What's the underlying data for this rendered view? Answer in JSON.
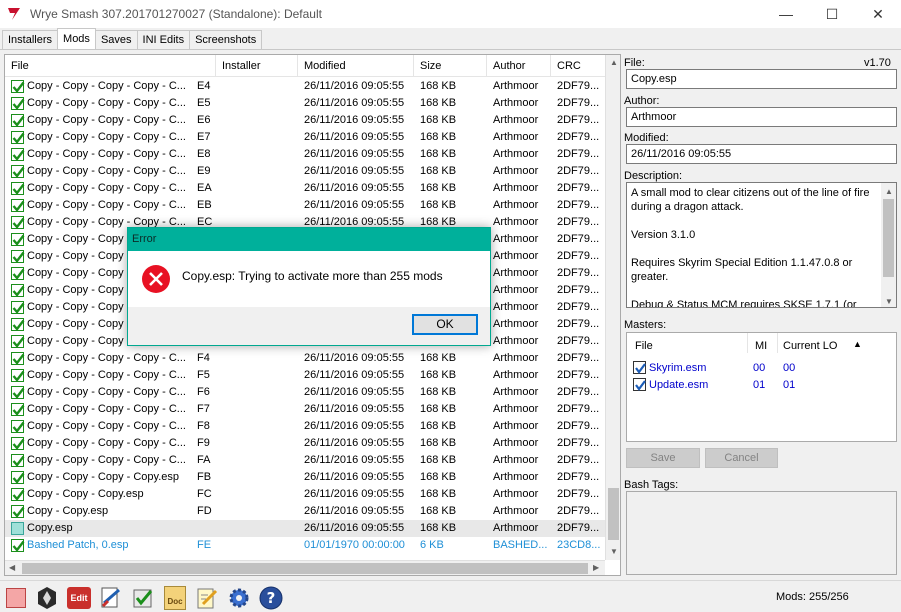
{
  "window": {
    "title": "Wrye Smash 307.201701270027 (Standalone): Default",
    "minimize_glyph": "—",
    "maximize_glyph": "☐",
    "close_glyph": "✕"
  },
  "tabs": [
    {
      "label": "Installers"
    },
    {
      "label": "Mods"
    },
    {
      "label": "Saves"
    },
    {
      "label": "INI Edits"
    },
    {
      "label": "Screenshots"
    }
  ],
  "modlist": {
    "columns": [
      {
        "label": "File"
      },
      {
        "label": "Installer"
      },
      {
        "label": "Modified"
      },
      {
        "label": "Size"
      },
      {
        "label": "Author"
      },
      {
        "label": "CRC"
      }
    ],
    "rows": [
      {
        "file": "Copy - Copy - Copy - Copy - C...",
        "lo": "E4",
        "installer": "",
        "modified": "26/11/2016 09:05:55",
        "size": "168 KB",
        "author": "Arthmoor",
        "crc": "2DF79...",
        "state": "checked"
      },
      {
        "file": "Copy - Copy - Copy - Copy - C...",
        "lo": "E5",
        "installer": "",
        "modified": "26/11/2016 09:05:55",
        "size": "168 KB",
        "author": "Arthmoor",
        "crc": "2DF79...",
        "state": "checked"
      },
      {
        "file": "Copy - Copy - Copy - Copy - C...",
        "lo": "E6",
        "installer": "",
        "modified": "26/11/2016 09:05:55",
        "size": "168 KB",
        "author": "Arthmoor",
        "crc": "2DF79...",
        "state": "checked"
      },
      {
        "file": "Copy - Copy - Copy - Copy - C...",
        "lo": "E7",
        "installer": "",
        "modified": "26/11/2016 09:05:55",
        "size": "168 KB",
        "author": "Arthmoor",
        "crc": "2DF79...",
        "state": "checked"
      },
      {
        "file": "Copy - Copy - Copy - Copy - C...",
        "lo": "E8",
        "installer": "",
        "modified": "26/11/2016 09:05:55",
        "size": "168 KB",
        "author": "Arthmoor",
        "crc": "2DF79...",
        "state": "checked"
      },
      {
        "file": "Copy - Copy - Copy - Copy - C...",
        "lo": "E9",
        "installer": "",
        "modified": "26/11/2016 09:05:55",
        "size": "168 KB",
        "author": "Arthmoor",
        "crc": "2DF79...",
        "state": "checked"
      },
      {
        "file": "Copy - Copy - Copy - Copy - C...",
        "lo": "EA",
        "installer": "",
        "modified": "26/11/2016 09:05:55",
        "size": "168 KB",
        "author": "Arthmoor",
        "crc": "2DF79...",
        "state": "checked"
      },
      {
        "file": "Copy - Copy - Copy - Copy - C...",
        "lo": "EB",
        "installer": "",
        "modified": "26/11/2016 09:05:55",
        "size": "168 KB",
        "author": "Arthmoor",
        "crc": "2DF79...",
        "state": "checked"
      },
      {
        "file": "Copy - Copy - Copy - Copy - C...",
        "lo": "EC",
        "installer": "",
        "modified": "26/11/2016 09:05:55",
        "size": "168 KB",
        "author": "Arthmoor",
        "crc": "2DF79...",
        "state": "checked"
      },
      {
        "file": "Copy - Copy - Copy",
        "lo": "",
        "installer": "",
        "modified": "",
        "size": "",
        "author": "Arthmoor",
        "crc": "2DF79...",
        "state": "checked"
      },
      {
        "file": "Copy - Copy - Copy",
        "lo": "",
        "installer": "",
        "modified": "",
        "size": "",
        "author": "Arthmoor",
        "crc": "2DF79...",
        "state": "checked"
      },
      {
        "file": "Copy - Copy - Copy",
        "lo": "",
        "installer": "",
        "modified": "",
        "size": "",
        "author": "Arthmoor",
        "crc": "2DF79...",
        "state": "checked"
      },
      {
        "file": "Copy - Copy - Copy",
        "lo": "",
        "installer": "",
        "modified": "",
        "size": "",
        "author": "Arthmoor",
        "crc": "2DF79...",
        "state": "checked"
      },
      {
        "file": "Copy - Copy - Copy",
        "lo": "",
        "installer": "",
        "modified": "",
        "size": "",
        "author": "Arthmoor",
        "crc": "2DF79...",
        "state": "checked"
      },
      {
        "file": "Copy - Copy - Copy",
        "lo": "",
        "installer": "",
        "modified": "",
        "size": "",
        "author": "Arthmoor",
        "crc": "2DF79...",
        "state": "checked"
      },
      {
        "file": "Copy - Copy - Copy",
        "lo": "",
        "installer": "",
        "modified": "",
        "size": "",
        "author": "Arthmoor",
        "crc": "2DF79...",
        "state": "checked"
      },
      {
        "file": "Copy - Copy - Copy - Copy - C...",
        "lo": "F4",
        "installer": "",
        "modified": "26/11/2016 09:05:55",
        "size": "168 KB",
        "author": "Arthmoor",
        "crc": "2DF79...",
        "state": "checked"
      },
      {
        "file": "Copy - Copy - Copy - Copy - C...",
        "lo": "F5",
        "installer": "",
        "modified": "26/11/2016 09:05:55",
        "size": "168 KB",
        "author": "Arthmoor",
        "crc": "2DF79...",
        "state": "checked"
      },
      {
        "file": "Copy - Copy - Copy - Copy - C...",
        "lo": "F6",
        "installer": "",
        "modified": "26/11/2016 09:05:55",
        "size": "168 KB",
        "author": "Arthmoor",
        "crc": "2DF79...",
        "state": "checked"
      },
      {
        "file": "Copy - Copy - Copy - Copy - C...",
        "lo": "F7",
        "installer": "",
        "modified": "26/11/2016 09:05:55",
        "size": "168 KB",
        "author": "Arthmoor",
        "crc": "2DF79...",
        "state": "checked"
      },
      {
        "file": "Copy - Copy - Copy - Copy - C...",
        "lo": "F8",
        "installer": "",
        "modified": "26/11/2016 09:05:55",
        "size": "168 KB",
        "author": "Arthmoor",
        "crc": "2DF79...",
        "state": "checked"
      },
      {
        "file": "Copy - Copy - Copy - Copy - C...",
        "lo": "F9",
        "installer": "",
        "modified": "26/11/2016 09:05:55",
        "size": "168 KB",
        "author": "Arthmoor",
        "crc": "2DF79...",
        "state": "checked"
      },
      {
        "file": "Copy - Copy - Copy - Copy - C...",
        "lo": "FA",
        "installer": "",
        "modified": "26/11/2016 09:05:55",
        "size": "168 KB",
        "author": "Arthmoor",
        "crc": "2DF79...",
        "state": "checked"
      },
      {
        "file": "Copy - Copy - Copy - Copy.esp",
        "lo": "FB",
        "installer": "",
        "modified": "26/11/2016 09:05:55",
        "size": "168 KB",
        "author": "Arthmoor",
        "crc": "2DF79...",
        "state": "checked"
      },
      {
        "file": "Copy - Copy - Copy.esp",
        "lo": "FC",
        "installer": "",
        "modified": "26/11/2016 09:05:55",
        "size": "168 KB",
        "author": "Arthmoor",
        "crc": "2DF79...",
        "state": "checked"
      },
      {
        "file": "Copy - Copy.esp",
        "lo": "FD",
        "installer": "",
        "modified": "26/11/2016 09:05:55",
        "size": "168 KB",
        "author": "Arthmoor",
        "crc": "2DF79...",
        "state": "checked"
      },
      {
        "file": "Copy.esp",
        "lo": "",
        "installer": "",
        "modified": "26/11/2016 09:05:55",
        "size": "168 KB",
        "author": "Arthmoor",
        "crc": "2DF79...",
        "state": "unchecked-selected"
      },
      {
        "file": "Bashed Patch, 0.esp",
        "lo": "FE",
        "installer": "",
        "modified": "01/01/1970 00:00:00",
        "size": "6 KB",
        "author": "BASHED...",
        "crc": "23CD8...",
        "state": "checked-blue"
      }
    ]
  },
  "details": {
    "file_label": "File:",
    "version": "v1.70",
    "file_value": "Copy.esp",
    "author_label": "Author:",
    "author_value": "Arthmoor",
    "modified_label": "Modified:",
    "modified_value": "26/11/2016 09:05:55",
    "description_label": "Description:",
    "description": [
      "A small mod to clear citizens out of the line of fire during a dragon attack.",
      "Version 3.1.0",
      "Requires Skyrim Special Edition 1.1.47.0.8 or greater.",
      "Debug & Status MCM requires SKSE 1.7.1 (or"
    ],
    "masters_label": "Masters:",
    "masters_columns": {
      "file": "File",
      "mi": "MI",
      "lo": "Current LO"
    },
    "masters": [
      {
        "name": "Skyrim.esm",
        "mi": "00",
        "lo": "00"
      },
      {
        "name": "Update.esm",
        "mi": "01",
        "lo": "01"
      }
    ],
    "save_label": "Save",
    "cancel_label": "Cancel",
    "bash_tags_label": "Bash Tags:"
  },
  "status": {
    "mods_count": "Mods: 255/256",
    "edit_icon_text": "Edit",
    "doc_icon_text": "Doc"
  },
  "dialog": {
    "title": "Error",
    "message": "Copy.esp: Trying to activate more than 255 mods",
    "ok_label": "OK"
  },
  "colors": {
    "accent": "#00b09b",
    "check_green": "#1b8f1b",
    "bashed_blue": "#1e8fd6",
    "error_red": "#e81123",
    "link_blue": "#0000cc"
  }
}
